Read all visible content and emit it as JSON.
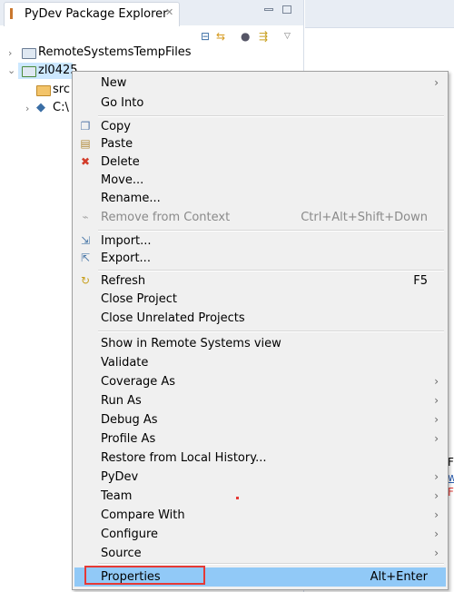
{
  "panel": {
    "title": "PyDev Package Explorer",
    "close_icon": "close-icon",
    "toolbar_icons": [
      "collapse-all-icon",
      "link-with-editor-icon",
      "filters-icon",
      "view-menu-icon"
    ]
  },
  "tree": [
    {
      "label": "RemoteSystemsTempFiles",
      "expanded": false,
      "icon": "folder-icon"
    },
    {
      "label": "zl0425",
      "expanded": true,
      "selected": true,
      "icon": "project-folder-icon"
    },
    {
      "label": "src",
      "icon": "source-folder-icon"
    },
    {
      "label": "C:\\",
      "expanded": false,
      "icon": "python-icon"
    }
  ],
  "background": {
    "fragment1": "F",
    "fragment2": "w",
    "fragment3": "F"
  },
  "colors": {
    "highlight": "#91c9f7",
    "annotation_box": "#e53935",
    "selection": "#cce8ff"
  },
  "menu": {
    "items": [
      {
        "label": "New",
        "submenu": true
      },
      {
        "label": "Go Into"
      },
      {
        "label": "Copy",
        "icon": "copy-icon"
      },
      {
        "label": "Paste",
        "icon": "paste-icon"
      },
      {
        "label": "Delete",
        "icon": "delete-icon"
      },
      {
        "label": "Move..."
      },
      {
        "label": "Rename..."
      },
      {
        "label": "Remove from Context",
        "shortcut": "Ctrl+Alt+Shift+Down",
        "disabled": true,
        "icon": "remove-context-icon"
      },
      {
        "label": "Import...",
        "icon": "import-icon"
      },
      {
        "label": "Export...",
        "icon": "export-icon"
      },
      {
        "label": "Refresh",
        "shortcut": "F5",
        "icon": "refresh-icon"
      },
      {
        "label": "Close Project"
      },
      {
        "label": "Close Unrelated Projects"
      },
      {
        "label": "Show in Remote Systems view"
      },
      {
        "label": "Validate"
      },
      {
        "label": "Coverage As",
        "submenu": true
      },
      {
        "label": "Run As",
        "submenu": true
      },
      {
        "label": "Debug As",
        "submenu": true
      },
      {
        "label": "Profile As",
        "submenu": true
      },
      {
        "label": "Restore from Local History..."
      },
      {
        "label": "PyDev",
        "submenu": true
      },
      {
        "label": "Team",
        "submenu": true
      },
      {
        "label": "Compare With",
        "submenu": true
      },
      {
        "label": "Configure",
        "submenu": true
      },
      {
        "label": "Source",
        "submenu": true
      },
      {
        "label": "Properties",
        "shortcut": "Alt+Enter",
        "highlighted": true
      }
    ]
  }
}
